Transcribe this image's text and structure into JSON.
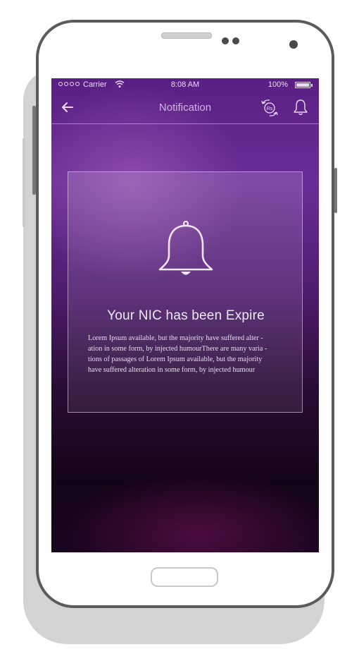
{
  "status_bar": {
    "carrier": "Carrier",
    "time": "8:08 AM",
    "battery_percent": "100%"
  },
  "nav": {
    "title": "Notification"
  },
  "notification": {
    "title": "Your NIC has been Expire",
    "body_lines": [
      "Lorem Ipsum available, but the majority have suffered alter -",
      "ation in some form, by injected humourThere are many varia -",
      "tions of passages of Lorem Ipsum available, but the majority",
      "have suffered alteration in some form, by injected humour"
    ]
  },
  "icons": {
    "back": "arrow-left-icon",
    "currency": "rupee-exchange-icon",
    "bell": "bell-icon"
  },
  "colors": {
    "screen_top": "#5a1f84",
    "screen_bottom": "#150418",
    "text_light": "#efe6f4",
    "phone_frame": "#5b5b5b"
  }
}
